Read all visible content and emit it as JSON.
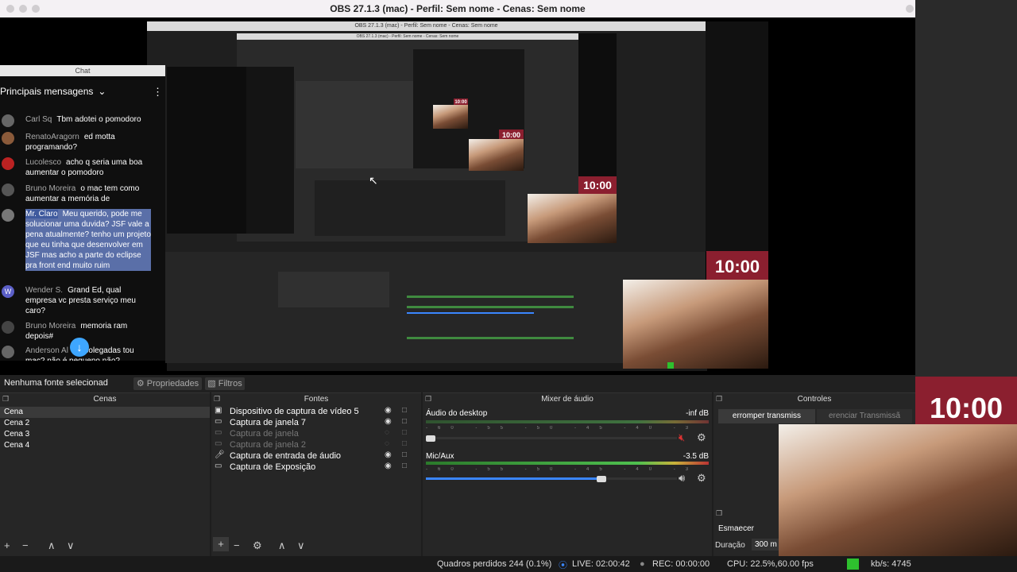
{
  "window": {
    "title": "OBS 27.1.3 (mac) - Perfil: Sem nome - Cenas: Sem nome"
  },
  "nested_titles": [
    "OBS 27.1.3 (mac) - Perfil: Sem nome - Cenas: Sem nome",
    "OBS 27.1.3 (mac) - Perfil: Sem nome - Cenas: Sem nome"
  ],
  "chat": {
    "header": "Chat",
    "title": "Principais mensagens",
    "messages": [
      {
        "author": "Carl Sq",
        "text": "Tbm adotei o pomodoro",
        "highlight": false
      },
      {
        "author": "RenatoAragorn",
        "text": "ed motta programando?",
        "highlight": false
      },
      {
        "author": "Lucolesco",
        "text": "acho q seria uma boa aumentar o pomodoro",
        "highlight": false
      },
      {
        "author": "Bruno Moreira",
        "text": "o mac tem como aumentar a memória de",
        "highlight": false
      },
      {
        "author": "Mr. Claro",
        "text": "Meu querido, pode me solucionar uma duvida? JSF vale a pena atualmente? tenho um projeto que eu tinha que desenvolver em JSF mas acho a parte do eclipse pra front end muito ruim",
        "highlight": true
      },
      {
        "author": "Wender S.",
        "text": "Grand Ed, qual empresa vc presta serviço meu caro?",
        "highlight": false
      },
      {
        "author": "Bruno Moreira",
        "text": "memoria ram depois#",
        "highlight": false
      },
      {
        "author": "Anderson Al",
        "text": "13 polegadas tou mac? não é pequeno não?",
        "highlight": false
      }
    ],
    "avatar_initial_w": "W"
  },
  "timer": {
    "value": "10:00"
  },
  "properties_bar": {
    "no_source": "Nenhuma fonte selecionad",
    "properties": "Propriedades",
    "filters": "Filtros"
  },
  "scenes": {
    "title": "Cenas",
    "items": [
      "Cena",
      "Cena 2",
      "Cena 3",
      "Cena 4"
    ]
  },
  "sources": {
    "title": "Fontes",
    "items": [
      {
        "label": "Dispositivo de captura de vídeo 5",
        "enabled": true
      },
      {
        "label": "Captura de janela 7",
        "enabled": true
      },
      {
        "label": "Captura de janela",
        "enabled": false
      },
      {
        "label": "Captura de janela 2",
        "enabled": false
      },
      {
        "label": "Captura de entrada de áudio",
        "enabled": true
      },
      {
        "label": "Captura de Exposição",
        "enabled": true
      }
    ]
  },
  "mixer": {
    "title": "Mixer de áudio",
    "channels": [
      {
        "name": "Áudio do desktop",
        "level": "-inf dB",
        "volume": 0.02,
        "muted": true
      },
      {
        "name": "Mic/Aux",
        "level": "-3.5 dB",
        "volume": 0.7,
        "muted": false
      }
    ],
    "tick_labels": "-60 -55 -50 -45 -40 -35 -30 -25 -20 -15 -10 -5 0"
  },
  "controls": {
    "title": "Controles",
    "stop_stream": "erromper transmiss",
    "manage_stream": "erenciar Transmissã",
    "fade": "Esmaecer",
    "duration_label": "Duração",
    "duration_value": "300 m"
  },
  "status": {
    "dropped": "Quadros perdidos 244 (0.1%)",
    "live": "LIVE: 02:00:42",
    "rec": "REC: 00:00:00",
    "cpu": "CPU: 22.5%,60.00 fps",
    "kbps": "kb/s: 4745"
  },
  "colors": {
    "accent": "#3ea6ff",
    "timer_bg": "#8b1f2f",
    "bitrate_indicator": "#2ec02e"
  }
}
